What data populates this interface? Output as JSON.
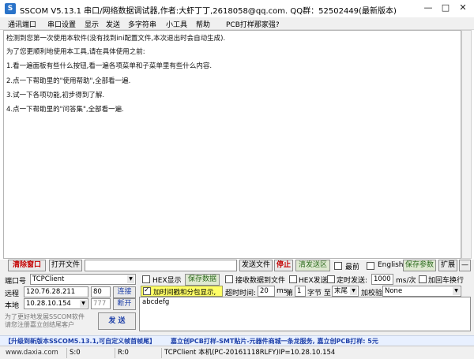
{
  "window": {
    "title": "SSCOM V5.13.1 串口/网络数据调试器,作者:大虾丁丁,2618058@qq.com. QQ群：52502449(最新版本)",
    "icon_letter": "S"
  },
  "menu": {
    "items": [
      "通讯端口",
      "串口设置",
      "显示",
      "发送",
      "多字符串",
      "小工具",
      "帮助",
      "PCB打样那家强?"
    ]
  },
  "receive_area": {
    "lines": [
      "检测到您第一次使用本软件(没有找到ini配置文件,本次退出时会自动生成).",
      "为了您更顺利地使用本工具,请在具体使用之前:",
      "1.看一遍面板有些什么按钮,看一遍各项菜单和子菜单里有些什么内容.",
      "2.点一下帮助里的\"使用帮助\",全部看一遍.",
      "3.试一下各项功能,初步得到了解.",
      "4.点一下帮助里的\"问答集\",全部看一遍."
    ]
  },
  "toolbar": {
    "clear_window": "清除窗口",
    "open_file": "打开文件",
    "send_file": "发送文件",
    "stop": "停止",
    "clear_send": "清发送区",
    "topmost": "最前",
    "english": "English",
    "save_params": "保存参数",
    "expand": "扩展",
    "dash": "—"
  },
  "port": {
    "label": "端口号",
    "value": "TCPClient",
    "remote_label": "远程",
    "remote_ip": "120.76.28.211",
    "remote_port": "80",
    "connect": "连接",
    "local_label": "本地",
    "local_ip": "10.28.10.154",
    "local_port": "777",
    "disconnect": "断开"
  },
  "options": {
    "hex_display": "HEX显示",
    "save_data": "保存数据",
    "recv_to_file": "接收数据到文件",
    "hex_send": "HEX发送",
    "timed_send": "定时发送:",
    "interval": "1000",
    "interval_unit": "ms/次",
    "add_crlf": "加回车换行",
    "timestamp": "加时间戳和分包显示,",
    "timeout_label": "超时时间:",
    "timeout_value": "20",
    "timeout_unit": "ms",
    "byte_nth_label": "第",
    "byte_nth_value": "1",
    "byte_unit": "字节 至",
    "byte_end": "末尾",
    "checksum_label": "加校验",
    "checksum_value": "None"
  },
  "send": {
    "text": "abcdefg",
    "button": "发 送",
    "note_line1": "为了更好地发展SSCOM软件",
    "note_line2": "请您注册嘉立创结尾客户"
  },
  "promo": {
    "left": "【升级到新版本SSCOM5.13.1,可自定义帧首帧尾】",
    "right": "嘉立创PCB打样-SMT贴片-元器件商城一条龙服务,  嘉立创PCB打样: 5元"
  },
  "status": {
    "site": "www.daxia.com",
    "sent": "S:0",
    "received": "R:0",
    "connection": "TCPClient 本机(PC-20161118RLFY)IP=10.28.10.154"
  },
  "colors": {
    "accent_red": "#c40000",
    "highlight_yellow": "#ffff66",
    "promo_blue": "#1d3fa8"
  }
}
